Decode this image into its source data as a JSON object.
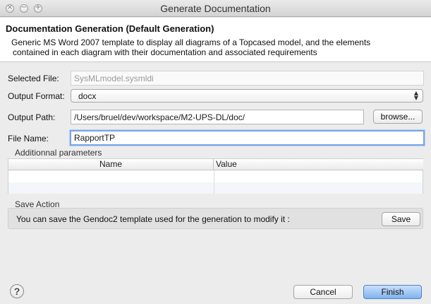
{
  "window": {
    "title": "Generate Documentation"
  },
  "header": {
    "title": "Documentation Generation (Default Generation)",
    "description_line1": "Generic MS Word 2007 template to display all diagrams of a Topcased model, and the elements",
    "description_line2": "contained in each diagram with their documentation and associated requirements"
  },
  "form": {
    "selected_file_label": "Selected File:",
    "selected_file_value": "SysMLmodel.sysmldi",
    "output_format_label": "Output Format:",
    "output_format_value": "docx",
    "output_path_label": "Output Path:",
    "output_path_value": "/Users/bruel/dev/workspace/M2-UPS-DL/doc/",
    "browse_label": "browse...",
    "file_name_label": "File Name:",
    "file_name_value": "RapportTP"
  },
  "params": {
    "group_label": "Additionnal parameters",
    "columns": [
      "Name",
      "Value"
    ]
  },
  "save_action": {
    "group_label": "Save Action",
    "text": "You can save the Gendoc2 template used for the generation to modify it :",
    "button_label": "Save"
  },
  "footer": {
    "help_glyph": "?",
    "cancel_label": "Cancel",
    "finish_label": "Finish"
  },
  "colors": {
    "accent": "#79a6e4",
    "primary_button": "#7fb2ef",
    "background": "#ececec"
  }
}
